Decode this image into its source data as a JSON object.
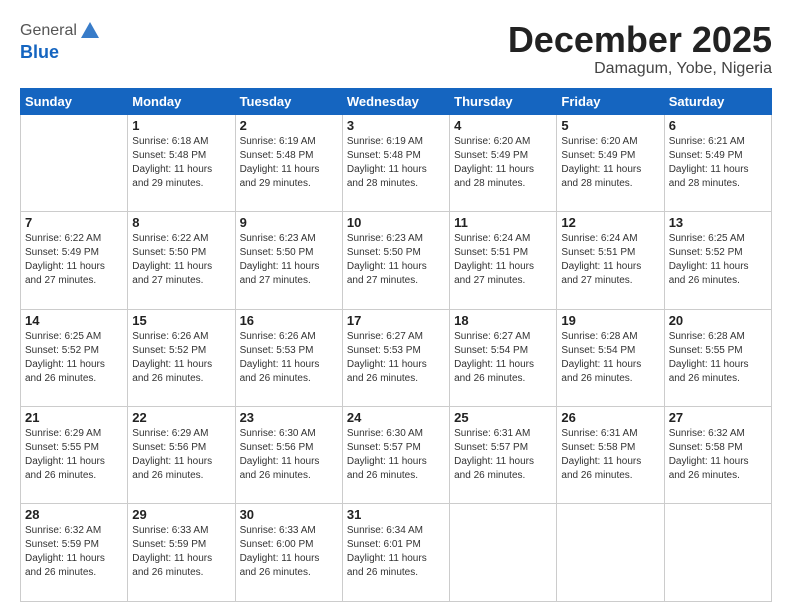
{
  "logo": {
    "general": "General",
    "blue": "Blue"
  },
  "header": {
    "month": "December 2025",
    "location": "Damagum, Yobe, Nigeria"
  },
  "weekdays": [
    "Sunday",
    "Monday",
    "Tuesday",
    "Wednesday",
    "Thursday",
    "Friday",
    "Saturday"
  ],
  "weeks": [
    [
      {
        "day": "",
        "info": ""
      },
      {
        "day": "1",
        "info": "Sunrise: 6:18 AM\nSunset: 5:48 PM\nDaylight: 11 hours\nand 29 minutes."
      },
      {
        "day": "2",
        "info": "Sunrise: 6:19 AM\nSunset: 5:48 PM\nDaylight: 11 hours\nand 29 minutes."
      },
      {
        "day": "3",
        "info": "Sunrise: 6:19 AM\nSunset: 5:48 PM\nDaylight: 11 hours\nand 28 minutes."
      },
      {
        "day": "4",
        "info": "Sunrise: 6:20 AM\nSunset: 5:49 PM\nDaylight: 11 hours\nand 28 minutes."
      },
      {
        "day": "5",
        "info": "Sunrise: 6:20 AM\nSunset: 5:49 PM\nDaylight: 11 hours\nand 28 minutes."
      },
      {
        "day": "6",
        "info": "Sunrise: 6:21 AM\nSunset: 5:49 PM\nDaylight: 11 hours\nand 28 minutes."
      }
    ],
    [
      {
        "day": "7",
        "info": "Sunrise: 6:22 AM\nSunset: 5:49 PM\nDaylight: 11 hours\nand 27 minutes."
      },
      {
        "day": "8",
        "info": "Sunrise: 6:22 AM\nSunset: 5:50 PM\nDaylight: 11 hours\nand 27 minutes."
      },
      {
        "day": "9",
        "info": "Sunrise: 6:23 AM\nSunset: 5:50 PM\nDaylight: 11 hours\nand 27 minutes."
      },
      {
        "day": "10",
        "info": "Sunrise: 6:23 AM\nSunset: 5:50 PM\nDaylight: 11 hours\nand 27 minutes."
      },
      {
        "day": "11",
        "info": "Sunrise: 6:24 AM\nSunset: 5:51 PM\nDaylight: 11 hours\nand 27 minutes."
      },
      {
        "day": "12",
        "info": "Sunrise: 6:24 AM\nSunset: 5:51 PM\nDaylight: 11 hours\nand 27 minutes."
      },
      {
        "day": "13",
        "info": "Sunrise: 6:25 AM\nSunset: 5:52 PM\nDaylight: 11 hours\nand 26 minutes."
      }
    ],
    [
      {
        "day": "14",
        "info": "Sunrise: 6:25 AM\nSunset: 5:52 PM\nDaylight: 11 hours\nand 26 minutes."
      },
      {
        "day": "15",
        "info": "Sunrise: 6:26 AM\nSunset: 5:52 PM\nDaylight: 11 hours\nand 26 minutes."
      },
      {
        "day": "16",
        "info": "Sunrise: 6:26 AM\nSunset: 5:53 PM\nDaylight: 11 hours\nand 26 minutes."
      },
      {
        "day": "17",
        "info": "Sunrise: 6:27 AM\nSunset: 5:53 PM\nDaylight: 11 hours\nand 26 minutes."
      },
      {
        "day": "18",
        "info": "Sunrise: 6:27 AM\nSunset: 5:54 PM\nDaylight: 11 hours\nand 26 minutes."
      },
      {
        "day": "19",
        "info": "Sunrise: 6:28 AM\nSunset: 5:54 PM\nDaylight: 11 hours\nand 26 minutes."
      },
      {
        "day": "20",
        "info": "Sunrise: 6:28 AM\nSunset: 5:55 PM\nDaylight: 11 hours\nand 26 minutes."
      }
    ],
    [
      {
        "day": "21",
        "info": "Sunrise: 6:29 AM\nSunset: 5:55 PM\nDaylight: 11 hours\nand 26 minutes."
      },
      {
        "day": "22",
        "info": "Sunrise: 6:29 AM\nSunset: 5:56 PM\nDaylight: 11 hours\nand 26 minutes."
      },
      {
        "day": "23",
        "info": "Sunrise: 6:30 AM\nSunset: 5:56 PM\nDaylight: 11 hours\nand 26 minutes."
      },
      {
        "day": "24",
        "info": "Sunrise: 6:30 AM\nSunset: 5:57 PM\nDaylight: 11 hours\nand 26 minutes."
      },
      {
        "day": "25",
        "info": "Sunrise: 6:31 AM\nSunset: 5:57 PM\nDaylight: 11 hours\nand 26 minutes."
      },
      {
        "day": "26",
        "info": "Sunrise: 6:31 AM\nSunset: 5:58 PM\nDaylight: 11 hours\nand 26 minutes."
      },
      {
        "day": "27",
        "info": "Sunrise: 6:32 AM\nSunset: 5:58 PM\nDaylight: 11 hours\nand 26 minutes."
      }
    ],
    [
      {
        "day": "28",
        "info": "Sunrise: 6:32 AM\nSunset: 5:59 PM\nDaylight: 11 hours\nand 26 minutes."
      },
      {
        "day": "29",
        "info": "Sunrise: 6:33 AM\nSunset: 5:59 PM\nDaylight: 11 hours\nand 26 minutes."
      },
      {
        "day": "30",
        "info": "Sunrise: 6:33 AM\nSunset: 6:00 PM\nDaylight: 11 hours\nand 26 minutes."
      },
      {
        "day": "31",
        "info": "Sunrise: 6:34 AM\nSunset: 6:01 PM\nDaylight: 11 hours\nand 26 minutes."
      },
      {
        "day": "",
        "info": ""
      },
      {
        "day": "",
        "info": ""
      },
      {
        "day": "",
        "info": ""
      }
    ]
  ]
}
